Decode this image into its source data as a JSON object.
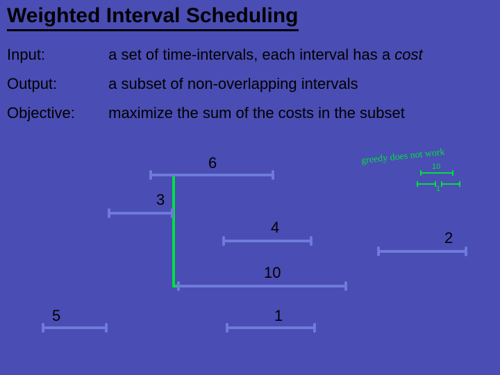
{
  "title": "Weighted Interval Scheduling",
  "rows": {
    "input": {
      "label": "Input:",
      "value_prefix": "a set of time-intervals, each interval has a ",
      "value_italic": "cost"
    },
    "output": {
      "label": "Output:",
      "value": "a subset of non-overlapping intervals"
    },
    "objective": {
      "label": "Objective:",
      "value": "maximize the sum of the costs in the subset"
    }
  },
  "intervals": {
    "i6": {
      "label": "6"
    },
    "i3": {
      "label": "3"
    },
    "i4": {
      "label": "4"
    },
    "i2": {
      "label": "2"
    },
    "i10": {
      "label": "10"
    },
    "i5": {
      "label": "5"
    },
    "i1": {
      "label": "1"
    }
  },
  "annotation": {
    "text": "greedy does not work",
    "mini_top": "10",
    "mini_bottom": "1"
  }
}
